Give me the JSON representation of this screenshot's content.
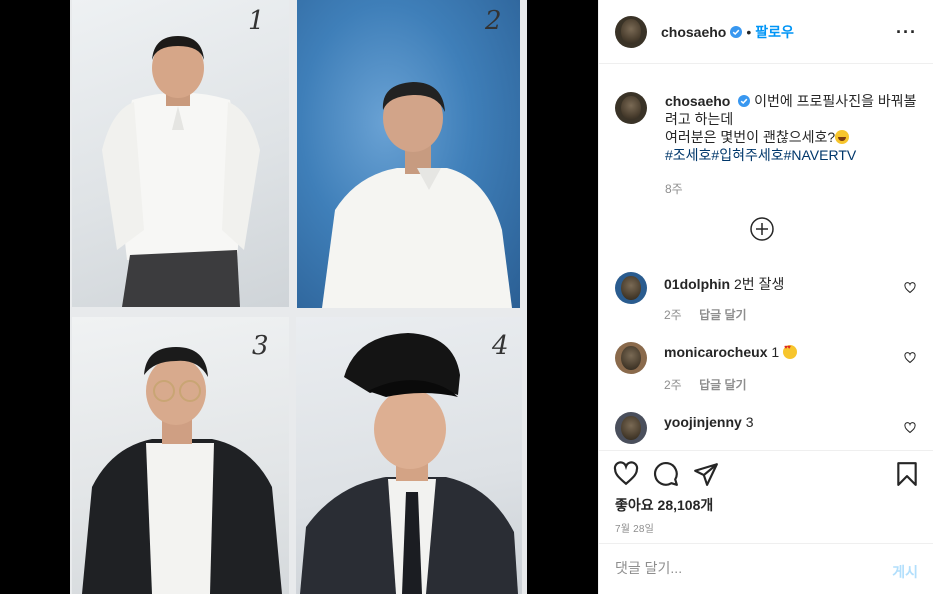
{
  "photo": {
    "panel_numbers": [
      "1",
      "2",
      "3",
      "4"
    ]
  },
  "header": {
    "username": "chosaeho",
    "dot": "•",
    "follow_label": "팔로우",
    "more_label": "···"
  },
  "caption": {
    "username": "chosaeho",
    "line1": "이번에 프로필사진을 바꿔볼려고 하는데",
    "line2": "여러분은 몇번이 괜찮으세호?",
    "hashtags": "#조세호#입혀주세호#NAVERTV",
    "time": "8주"
  },
  "comments": [
    {
      "username": "01dolphin",
      "text": "2번 잘생",
      "time": "2주",
      "reply_label": "답글 달기",
      "emoji": ""
    },
    {
      "username": "monicarocheux",
      "text": "1",
      "time": "2주",
      "reply_label": "답글 달기",
      "emoji": "heart-eyes-emoji"
    },
    {
      "username": "yoojinjenny",
      "text": "3",
      "time": "",
      "reply_label": "",
      "emoji": ""
    }
  ],
  "actions": {
    "likes": "좋아요 28,108개",
    "date": "7월 28일"
  },
  "comment_input": {
    "placeholder": "댓글 달기...",
    "post_label": "게시"
  },
  "colors": {
    "link_blue": "#0095f6",
    "hashtag_blue": "#00376b",
    "muted_gray": "#8e8e8e",
    "disabled_blue": "#b2dffc",
    "photo2_bg": "#3f7fb9"
  }
}
